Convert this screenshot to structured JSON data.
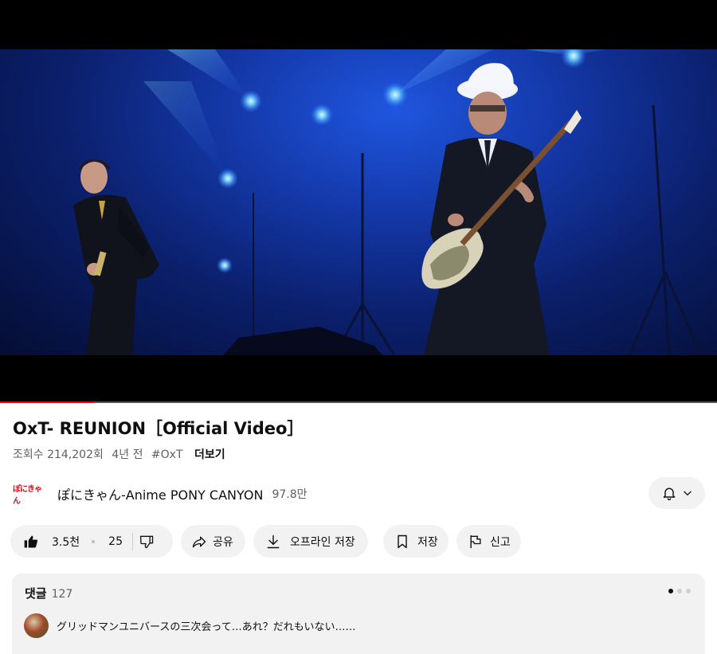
{
  "video": {
    "title": "OxT- REUNION［Official Video］",
    "progress_fraction": 0.13
  },
  "meta": {
    "views": "조회수 214,202회",
    "age": "4년 전",
    "hashtag": "#OxT",
    "more_label": "더보기"
  },
  "channel": {
    "logo_text": "ぽにきゃん",
    "name": "ぽにきゃん-Anime PONY CANYON",
    "subscribers": "97.8만",
    "bell_icon": "bell-icon"
  },
  "actions": {
    "like_count": "3.5천",
    "dislike_count": "25",
    "share_label": "공유",
    "download_label": "오프라인 저장",
    "save_label": "저장",
    "report_label": "신고"
  },
  "comments": {
    "label": "댓글",
    "count": "127",
    "first_comment": "グリッドマンユニバースの三次会って…あれ？だれもいない……",
    "page_dots": 3,
    "active_dot": 0
  },
  "colors": {
    "progress": "#ff0000",
    "pill_bg": "#f2f2f2",
    "stage_blue": "#1438a8"
  }
}
